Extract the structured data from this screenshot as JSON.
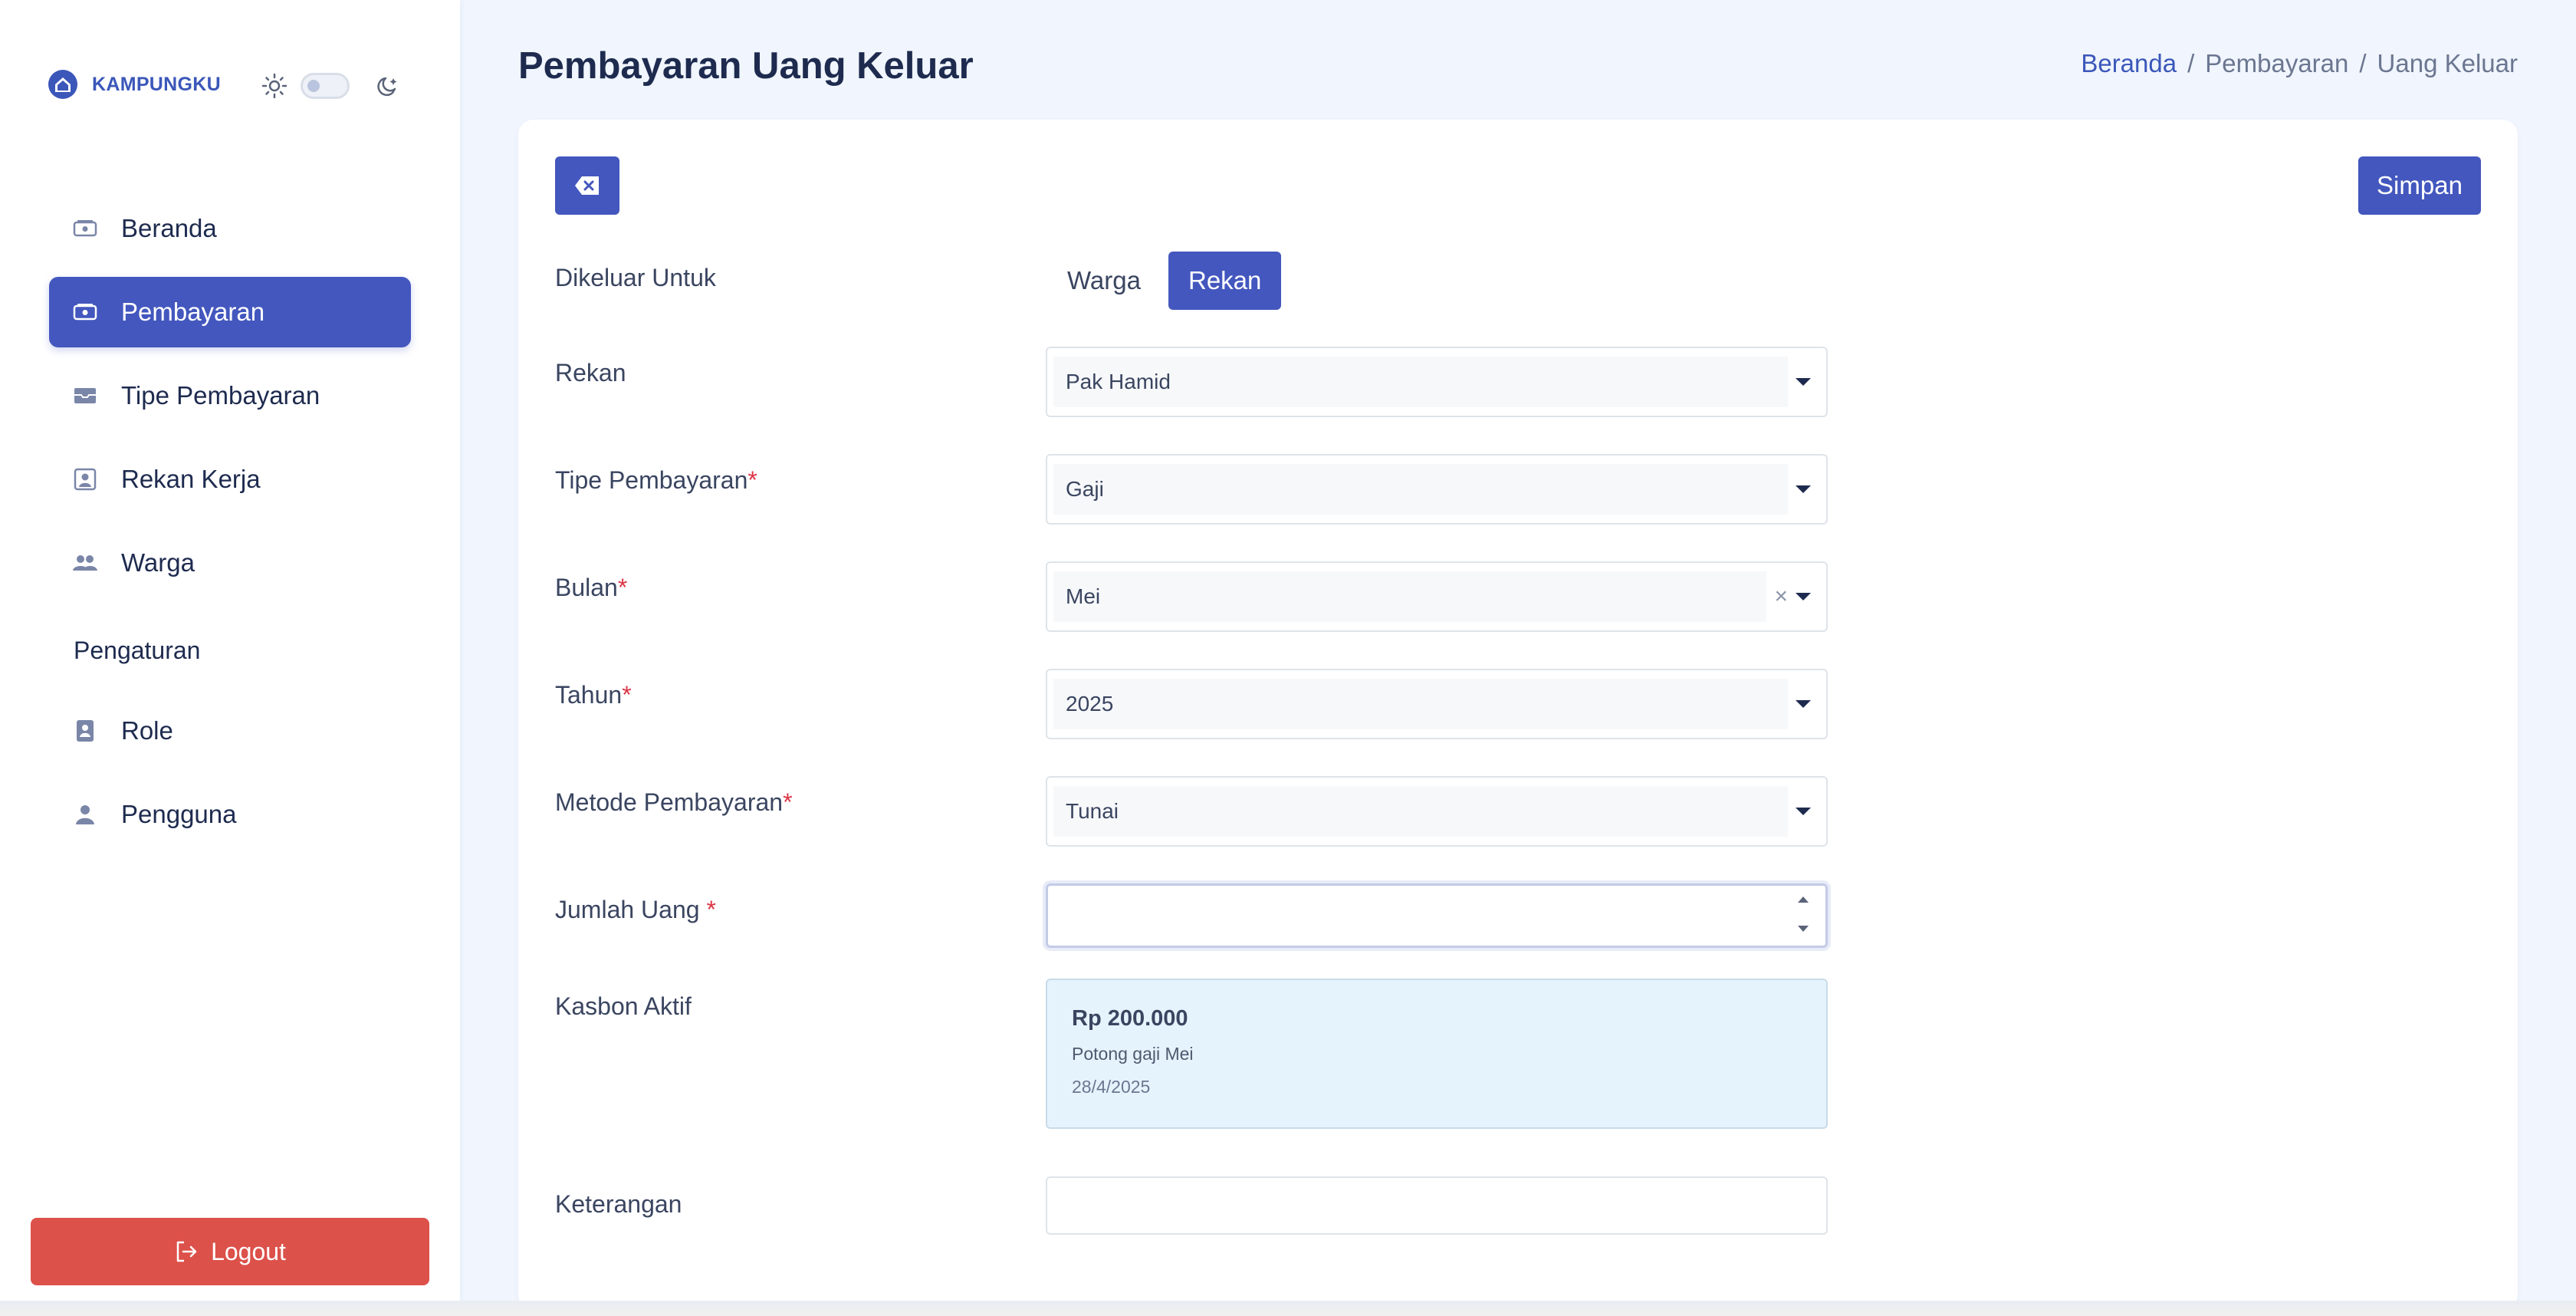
{
  "brand": {
    "name": "KAMPUNGKU"
  },
  "sidebar": {
    "items": [
      {
        "label": "Beranda",
        "icon": "cash-icon"
      },
      {
        "label": "Pembayaran",
        "icon": "cash-icon",
        "active": true
      },
      {
        "label": "Tipe Pembayaran",
        "icon": "tray-icon"
      },
      {
        "label": "Rekan Kerja",
        "icon": "contact-icon"
      },
      {
        "label": "Warga",
        "icon": "people-icon"
      }
    ],
    "section_label": "Pengaturan",
    "settings_items": [
      {
        "label": "Role",
        "icon": "badge-icon"
      },
      {
        "label": "Pengguna",
        "icon": "user-icon"
      }
    ],
    "logout_label": "Logout"
  },
  "header": {
    "title": "Pembayaran Uang Keluar",
    "breadcrumb": [
      "Beranda",
      "Pembayaran",
      "Uang Keluar"
    ],
    "separator": "/"
  },
  "form": {
    "save_label": "Simpan",
    "dikeluar_untuk": {
      "label": "Dikeluar Untuk",
      "options": [
        "Warga",
        "Rekan"
      ],
      "selected": "Rekan"
    },
    "rekan": {
      "label": "Rekan",
      "value": "Pak Hamid"
    },
    "tipe_pembayaran": {
      "label": "Tipe Pembayaran",
      "value": "Gaji"
    },
    "bulan": {
      "label": "Bulan",
      "value": "Mei"
    },
    "tahun": {
      "label": "Tahun",
      "value": "2025"
    },
    "metode_pembayaran": {
      "label": "Metode Pembayaran",
      "value": "Tunai"
    },
    "jumlah_uang": {
      "label": "Jumlah Uang ",
      "value": ""
    },
    "kasbon_aktif": {
      "label": "Kasbon Aktif",
      "amount": "Rp 200.000",
      "description": "Potong gaji Mei",
      "date": "28/4/2025"
    },
    "keterangan": {
      "label": "Keterangan",
      "value": ""
    },
    "required_mark": "*"
  },
  "colors": {
    "accent": "#4357be",
    "danger": "#dc514a",
    "required": "#dc3545"
  }
}
